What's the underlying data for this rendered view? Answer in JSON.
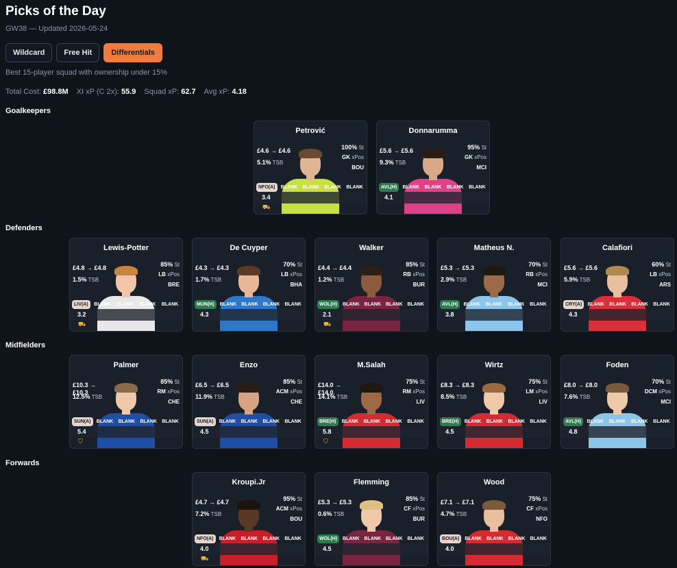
{
  "page": {
    "title": "Picks of the Day",
    "subtitle": "GW38 — Updated 2026-05-24",
    "tabs": [
      {
        "label": "Wildcard",
        "active": false
      },
      {
        "label": "Free Hit",
        "active": false
      },
      {
        "label": "Differentials",
        "active": true
      }
    ],
    "description": "Best 15-player squad with ownership under 15%",
    "stats": {
      "total_cost_label": "Total Cost:",
      "total_cost": "£98.8M",
      "xi_xp_label": "XI xP (C 2x):",
      "xi_xp": "55.9",
      "squad_xp_label": "Squad xP:",
      "squad_xp": "62.7",
      "avg_xp_label": "Avg xP:",
      "avg_xp": "4.18"
    }
  },
  "sections": {
    "goalkeepers": "Goalkeepers",
    "defenders": "Defenders",
    "midfielders": "Midfielders",
    "forwards": "Forwards"
  },
  "colors": {
    "accent": "#f07b3f",
    "fixture_away": "#e6d6cf",
    "fixture_home": "#2f7a4f"
  },
  "players": {
    "gk": [
      {
        "name": "Petrović",
        "price": "£4.6 → £4.6",
        "tsb": "5.1%",
        "start": "100%",
        "pos": "GK",
        "team": "BOU",
        "fixture": "NFO(A)",
        "fixture_type": "away",
        "xp": "3.4",
        "badge": "⛟",
        "kit": "#c8e040",
        "hair": "#6b4a2e",
        "skin": "#e0b596"
      },
      {
        "name": "Donnarumma",
        "price": "£5.6 → £5.6",
        "tsb": "9.3%",
        "start": "95%",
        "pos": "GK",
        "team": "MCI",
        "fixture": "AVL(H)",
        "fixture_type": "home",
        "xp": "4.1",
        "badge": "",
        "kit": "#e0408a",
        "hair": "#2a1d15",
        "skin": "#d8a888"
      }
    ],
    "def": [
      {
        "name": "Lewis-Potter",
        "price": "£4.8 → £4.8",
        "tsb": "1.5%",
        "start": "85%",
        "pos": "LB",
        "team": "BRE",
        "fixture": "LIV(A)",
        "fixture_type": "away",
        "xp": "3.2",
        "badge": "⛟",
        "kit": "#e8e8e8",
        "hair": "#c9843e",
        "skin": "#f0c5a8"
      },
      {
        "name": "De Cuyper",
        "price": "£4.3 → £4.3",
        "tsb": "1.7%",
        "start": "70%",
        "pos": "LB",
        "team": "BHA",
        "fixture": "MUN(H)",
        "fixture_type": "home",
        "xp": "4.3",
        "badge": "",
        "kit": "#2e78c7",
        "hair": "#5a3a22",
        "skin": "#e8b896"
      },
      {
        "name": "Walker",
        "price": "£4.4 → £4.4",
        "tsb": "1.2%",
        "start": "85%",
        "pos": "RB",
        "team": "BUR",
        "fixture": "WOL(H)",
        "fixture_type": "home",
        "xp": "2.1",
        "badge": "⛟",
        "kit": "#7a2540",
        "hair": "#2b1f18",
        "skin": "#8c5a3c"
      },
      {
        "name": "Matheus N.",
        "price": "£5.3 → £5.3",
        "tsb": "2.9%",
        "start": "70%",
        "pos": "RB",
        "team": "MCI",
        "fixture": "AVL(H)",
        "fixture_type": "home",
        "xp": "3.8",
        "badge": "",
        "kit": "#8cc4ea",
        "hair": "#1f1712",
        "skin": "#9c6a48"
      },
      {
        "name": "Calafiori",
        "price": "£5.6 → £5.6",
        "tsb": "5.9%",
        "start": "60%",
        "pos": "LB",
        "team": "ARS",
        "fixture": "CRY(A)",
        "fixture_type": "away",
        "xp": "4.3",
        "badge": "",
        "kit": "#d8303a",
        "hair": "#b08850",
        "skin": "#e8c0a0"
      }
    ],
    "mid": [
      {
        "name": "Palmer",
        "price": "£10.3 → £10.3",
        "tsb": "12.5%",
        "start": "85%",
        "pos": "RM",
        "team": "CHE",
        "fixture": "SUN(A)",
        "fixture_type": "away",
        "xp": "5.4",
        "badge": "⛉",
        "kit": "#1f4ea8",
        "hair": "#8a6a48",
        "skin": "#f0c8aa"
      },
      {
        "name": "Enzo",
        "price": "£6.5 → £6.5",
        "tsb": "11.9%",
        "start": "85%",
        "pos": "ACM",
        "team": "CHE",
        "fixture": "SUN(A)",
        "fixture_type": "away",
        "xp": "4.5",
        "badge": "",
        "kit": "#1f4ea8",
        "hair": "#2a1d15",
        "skin": "#d6a482"
      },
      {
        "name": "M.Salah",
        "price": "£14.0 → £14.0",
        "tsb": "14.1%",
        "start": "75%",
        "pos": "RM",
        "team": "LIV",
        "fixture": "BRE(H)",
        "fixture_type": "home",
        "xp": "5.8",
        "badge": "⛉",
        "kit": "#d42a32",
        "hair": "#1f1712",
        "skin": "#9c6a48"
      },
      {
        "name": "Wirtz",
        "price": "£8.3 → £8.3",
        "tsb": "8.5%",
        "start": "75%",
        "pos": "LM",
        "team": "LIV",
        "fixture": "BRE(H)",
        "fixture_type": "home",
        "xp": "4.5",
        "badge": "",
        "kit": "#d42a32",
        "hair": "#9a6a40",
        "skin": "#f0c8aa"
      },
      {
        "name": "Foden",
        "price": "£8.0 → £8.0",
        "tsb": "7.6%",
        "start": "70%",
        "pos": "DCM",
        "team": "MCI",
        "fixture": "AVL(H)",
        "fixture_type": "home",
        "xp": "4.8",
        "badge": "",
        "kit": "#8cc4ea",
        "hair": "#7a5a3a",
        "skin": "#f0c8aa"
      }
    ],
    "fwd": [
      {
        "name": "Kroupi.Jr",
        "price": "£4.7 → £4.7",
        "tsb": "7.2%",
        "start": "95%",
        "pos": "ACM",
        "team": "BOU",
        "fixture": "NFO(A)",
        "fixture_type": "away",
        "xp": "4.0",
        "badge": "⛟",
        "kit": "#c8202a",
        "hair": "#1a1410",
        "skin": "#5a3826"
      },
      {
        "name": "Flemming",
        "price": "£5.3 → £5.3",
        "tsb": "0.6%",
        "start": "85%",
        "pos": "CF",
        "team": "BUR",
        "fixture": "WOL(H)",
        "fixture_type": "home",
        "xp": "4.5",
        "badge": "",
        "kit": "#7a2540",
        "hair": "#e0c080",
        "skin": "#f0c8aa"
      },
      {
        "name": "Wood",
        "price": "£7.1 → £7.1",
        "tsb": "4.7%",
        "start": "75%",
        "pos": "CF",
        "team": "NFO",
        "fixture": "BOU(A)",
        "fixture_type": "away",
        "xp": "4.0",
        "badge": "",
        "kit": "#d42a32",
        "hair": "#7a5a3a",
        "skin": "#e8c0a0"
      }
    ]
  },
  "labels": {
    "st": "St",
    "xpos": "xPos",
    "tsb": "TSB",
    "blank": "BLANK"
  }
}
